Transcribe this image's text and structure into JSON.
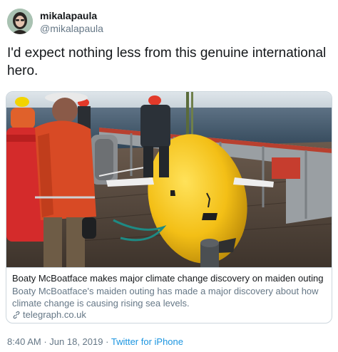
{
  "user": {
    "display_name": "mikalapaula",
    "handle": "@mikalapaula",
    "avatar_icon": "user-avatar-photo"
  },
  "tweet": {
    "text": "I'd expect nothing less from this genuine international hero."
  },
  "card": {
    "title": "Boaty McBoatface makes major climate change discovery on maiden outing",
    "description": "Boaty McBoatface's maiden outing has made a major discovery about how climate change is causing rising sea levels.",
    "domain": "telegraph.co.uk",
    "domain_icon": "link-icon"
  },
  "meta": {
    "time": "8:40 AM",
    "separator": "·",
    "date": "Jun 18, 2019",
    "source": "Twitter for iPhone"
  },
  "colors": {
    "text": "#14171a",
    "secondary": "#657786",
    "link": "#1b95e0",
    "border": "#ccd6dd"
  }
}
